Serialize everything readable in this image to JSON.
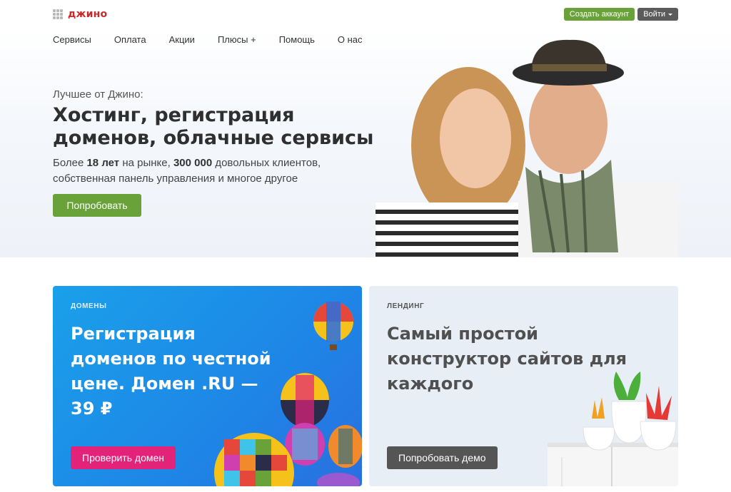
{
  "header": {
    "logo_text": "джино",
    "create_account": "Создать аккаунт",
    "login": "Войти"
  },
  "nav": {
    "items": [
      "Сервисы",
      "Оплата",
      "Акции",
      "Плюсы",
      "Помощь",
      "О нас"
    ],
    "plus_suffix": "+"
  },
  "hero": {
    "kicker": "Лучшее от Джино:",
    "title": "Хостинг, регистрация доменов, облачные сервисы",
    "desc_1": "Более ",
    "desc_years": "18 лет",
    "desc_2": " на рынке, ",
    "desc_clients": "300 000",
    "desc_3": " довольных клиентов, собственная панель управления и многое другое",
    "button": "Попробовать"
  },
  "cards": {
    "domains": {
      "tag": "ДОМЕНЫ",
      "title": "Регистрация доменов по честной цене. Домен .RU — 39 ₽",
      "button": "Проверить домен"
    },
    "landing": {
      "tag": "ЛЕНДИНГ",
      "title": "Самый простой конструктор сайтов для каждого",
      "button": "Попробовать демо"
    }
  },
  "colors": {
    "brand_red": "#c62a2a",
    "accent_green": "#6aa23a",
    "accent_pink": "#e3227a",
    "domains_blue": "#1e86e6"
  }
}
